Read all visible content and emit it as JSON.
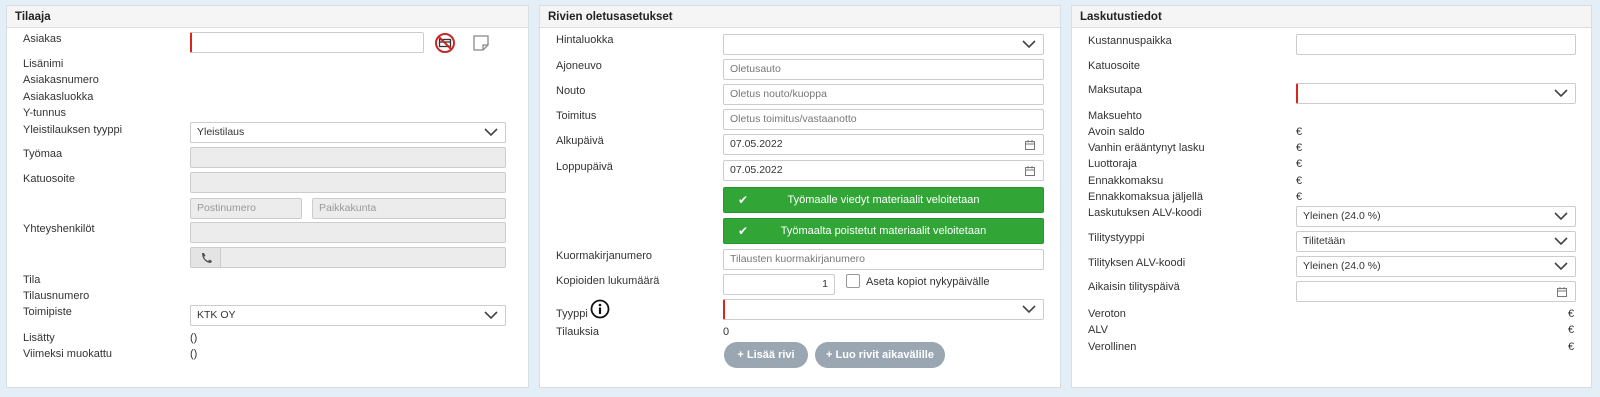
{
  "tilaaja": {
    "title": "Tilaaja",
    "labels": {
      "asiakas": "Asiakas",
      "lisanimi": "Lisänimi",
      "asiakasnumero": "Asiakasnumero",
      "asiakasluokka": "Asiakasluokka",
      "ytunnus": "Y-tunnus",
      "yleistilauksen_tyyppi": "Yleistilauksen tyyppi",
      "tyomaa": "Työmaa",
      "katuosoite": "Katuosoite",
      "yhteyshenkilot": "Yhteyshenkilöt",
      "tila": "Tila",
      "tilausnumero": "Tilausnumero",
      "toimipiste": "Toimipiste",
      "lisatty": "Lisätty",
      "viimeksi_muokattu": "Viimeksi muokattu"
    },
    "yleistilaus_value": "Yleistilaus",
    "postinumero_placeholder": "Postinumero",
    "paikkakunta_placeholder": "Paikkakunta",
    "toimipiste_value": "KTK OY",
    "lisatty_value": "()",
    "viimeksi_muokattu_value": "()"
  },
  "rivien": {
    "title": "Rivien oletusasetukset",
    "labels": {
      "hintaluokka": "Hintaluokka",
      "ajoneuvo": "Ajoneuvo",
      "nouto": "Nouto",
      "toimitus": "Toimitus",
      "alkupaiva": "Alkupäivä",
      "loppupaiva": "Loppupäivä",
      "kuormakirjanumero": "Kuormakirjanumero",
      "kopioiden_lukumaara": "Kopioiden lukumäärä",
      "tyyppi": "Tyyppi",
      "tilauksia": "Tilauksia"
    },
    "ajoneuvo_placeholder": "Oletusauto",
    "nouto_placeholder": "Oletus nouto/kuoppa",
    "toimitus_placeholder": "Oletus toimitus/vastaanotto",
    "alkupaiva_value": "07.05.2022",
    "loppupaiva_value": "07.05.2022",
    "btn_viedyt": "Työmaalle viedyt materiaalit veloitetaan",
    "btn_poistetut": "Työmaalta poistetut materiaalit veloitetaan",
    "kuormakirja_placeholder": "Tilausten kuormakirjanumero",
    "kopioiden_value": "1",
    "aseta_kopiot_label": "Aseta kopiot nykypäivälle",
    "tilauksia_value": "0",
    "btn_lisaa_rivi": "Lisää rivi",
    "btn_luo_rivit": "Luo rivit aikavälille"
  },
  "laskutus": {
    "title": "Laskutustiedot",
    "labels": {
      "kustannuspaikka": "Kustannuspaikka",
      "katuosoite": "Katuosoite",
      "maksutapa": "Maksutapa",
      "maksuehto": "Maksuehto",
      "avoin_saldo": "Avoin saldo",
      "vanhin_eraantynyt": "Vanhin erääntynyt lasku",
      "luottoraja": "Luottoraja",
      "ennakkomaksu": "Ennakkomaksu",
      "ennakkomaksua_jaljella": "Ennakkomaksua jäljellä",
      "laskutuksen_alv": "Laskutuksen ALV-koodi",
      "tilitystyyppi": "Tilitystyyppi",
      "tilityksen_alv": "Tilityksen ALV-koodi",
      "aikaisin_tilityspaiva": "Aikaisin tilityspäivä",
      "veroton": "Veroton",
      "alv": "ALV",
      "verollinen": "Verollinen"
    },
    "euro": "€",
    "laskutuksen_alv_value": "Yleinen (24.0 %)",
    "tilitystyyppi_value": "Tilitetään",
    "tilityksen_alv_value": "Yleinen (24.0 %)"
  },
  "colors": {
    "green": "#31a637",
    "required": "#d9251c",
    "disabled": "#ececec",
    "grey_button": "#9aa7b2"
  }
}
